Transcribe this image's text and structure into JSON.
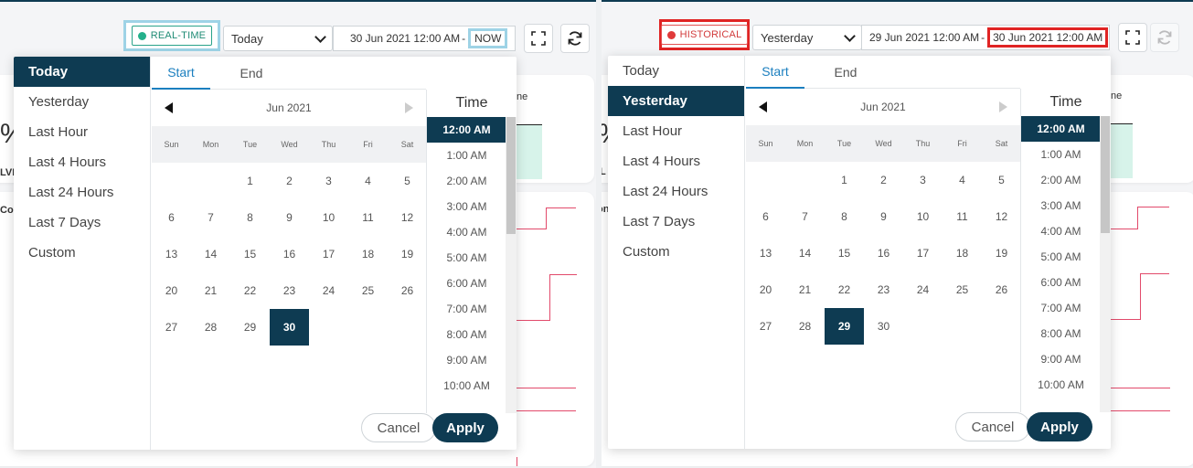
{
  "panels": [
    {
      "status": "REAL-TIME",
      "status_color": "#24b08b",
      "preset_value": "Today",
      "range_start": "30 Jun 2021 12:00 AM",
      "range_sep": "-",
      "range_end": "NOW",
      "presets": [
        "Today",
        "Yesterday",
        "Last Hour",
        "Last 4 Hours",
        "Last 24 Hours",
        "Last 7 Days",
        "Custom"
      ],
      "active_preset": "Today",
      "tabs": [
        "Start",
        "End"
      ],
      "month": "Jun 2021",
      "weekdays": [
        "Sun",
        "Mon",
        "Tue",
        "Wed",
        "Thu",
        "Fri",
        "Sat"
      ],
      "selected_day": "30",
      "time_title": "Time",
      "times": [
        "12:00 AM",
        "1:00 AM",
        "2:00 AM",
        "3:00 AM",
        "4:00 AM",
        "5:00 AM",
        "6:00 AM",
        "7:00 AM",
        "8:00 AM",
        "9:00 AM",
        "10:00 AM"
      ],
      "selected_time": "12:00 AM",
      "cancel": "Cancel",
      "apply": "Apply"
    },
    {
      "status": "HISTORICAL",
      "status_color": "#e03a3a",
      "preset_value": "Yesterday",
      "range_start": "29 Jun 2021 12:00 AM",
      "range_sep": "-",
      "range_end": "30 Jun 2021 12:00 AM",
      "presets": [
        "Today",
        "Yesterday",
        "Last Hour",
        "Last 4 Hours",
        "Last 24 Hours",
        "Last 7 Days",
        "Custom"
      ],
      "active_preset": "Yesterday",
      "tabs": [
        "Start",
        "End"
      ],
      "month": "Jun 2021",
      "weekdays": [
        "Sun",
        "Mon",
        "Tue",
        "Wed",
        "Thu",
        "Fri",
        "Sat"
      ],
      "selected_day": "29",
      "time_title": "Time",
      "times": [
        "12:00 AM",
        "1:00 AM",
        "2:00 AM",
        "3:00 AM",
        "4:00 AM",
        "5:00 AM",
        "6:00 AM",
        "7:00 AM",
        "8:00 AM",
        "9:00 AM",
        "10:00 AM"
      ],
      "selected_time": "12:00 AM",
      "cancel": "Cancel",
      "apply": "Apply"
    }
  ],
  "calendar_days": [
    "",
    "",
    "1",
    "2",
    "3",
    "4",
    "5",
    "6",
    "7",
    "8",
    "9",
    "10",
    "11",
    "12",
    "13",
    "14",
    "15",
    "16",
    "17",
    "18",
    "19",
    "20",
    "21",
    "22",
    "23",
    "24",
    "25",
    "26",
    "27",
    "28",
    "29",
    "30"
  ],
  "background": {
    "percent_glyph": "%",
    "label_ne": "ne",
    "label_lvl": "LVL",
    "label_co": "Co",
    "label_l": "L",
    "label_on": "on"
  },
  "icons": {
    "expand": "expand-icon",
    "refresh": "refresh-icon",
    "prev": "prev-month-icon",
    "next": "next-month-icon",
    "dropdown": "chevron-down-icon"
  }
}
